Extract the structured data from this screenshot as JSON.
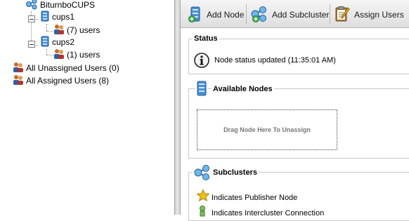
{
  "tree": {
    "root": {
      "label": "BiturnboCUPS",
      "icon": "cluster-icon"
    },
    "subclusters": [
      {
        "label": "cups1",
        "icon": "server-icon",
        "users_label": "(7) users",
        "users_icon": "users-icon"
      },
      {
        "label": "cups2",
        "icon": "server-icon",
        "users_label": "(1) users",
        "users_icon": "users-icon"
      }
    ],
    "unassigned_label": "All Unassigned Users (0)",
    "assigned_label": "All Assigned Users (8)"
  },
  "toolbar": {
    "add_node_label": "Add Node",
    "add_subcluster_label": "Add Subcluster",
    "assign_users_label": "Assign Users"
  },
  "status": {
    "title": "Status",
    "message": "Node status updated (11:35:01 AM)",
    "icon": "info-icon"
  },
  "available_nodes": {
    "title": "Available Nodes",
    "drop_text": "Drag Node Here To Unassign",
    "icon": "server-icon"
  },
  "subclusters_panel": {
    "title": "Subclusters",
    "icon": "cluster-icon",
    "legend_publisher": "Indicates Publisher Node",
    "legend_publisher_icon": "star-icon",
    "legend_intercluster": "Indicates Intercluster Connection",
    "legend_intercluster_icon": "intercluster-icon"
  },
  "colors": {
    "server_blue": "#3a7fc4",
    "star_yellow": "#f2c20c",
    "toolbar_bg": "#e4e4e4",
    "splitter": "#d2d2d2"
  }
}
